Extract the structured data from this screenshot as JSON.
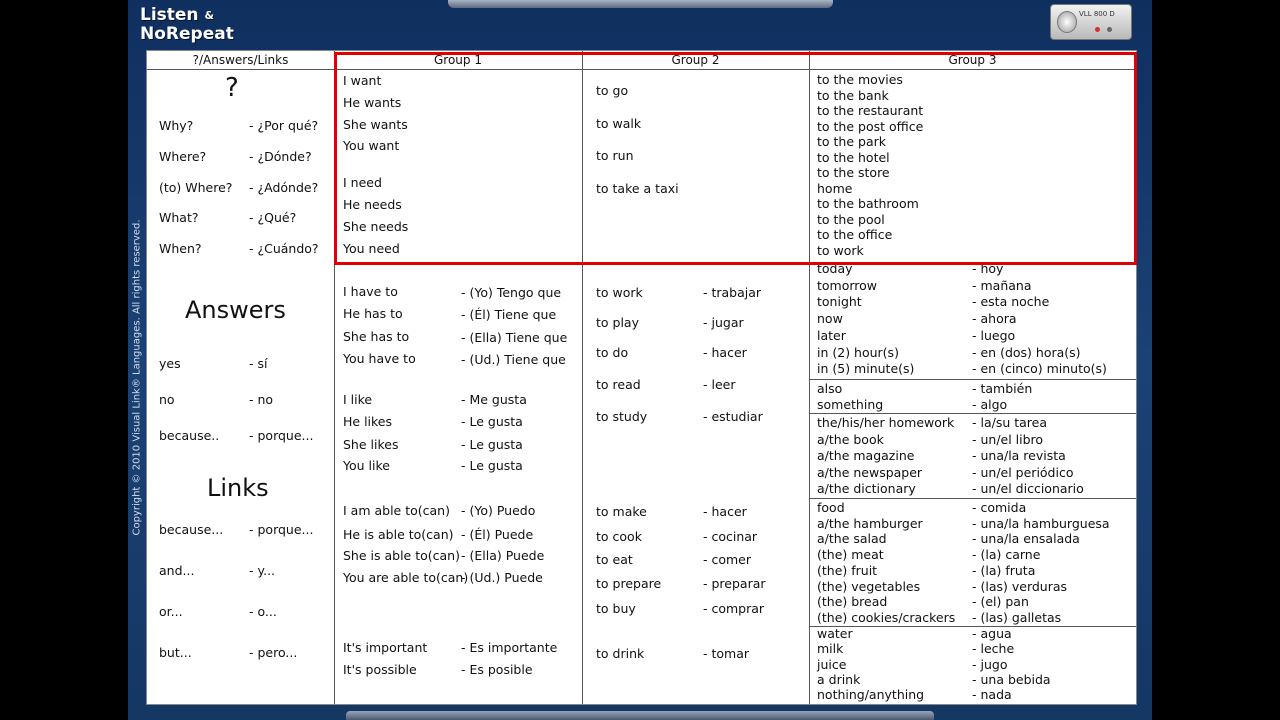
{
  "app": {
    "logo_line1": "Listen",
    "logo_amp": "&",
    "logo_line2": "NoRepeat",
    "device_label": "VLL 800 D",
    "copyright": "Copyright © 2010 Visual Link® Languages. All rights reserved."
  },
  "headers": {
    "col0": "?/Answers/Links",
    "group1": "Group 1",
    "group2": "Group 2",
    "group3": "Group 3"
  },
  "left": {
    "question_mark": "?",
    "questions": [
      {
        "en": "Why?",
        "es": "- ¿Por qué?"
      },
      {
        "en": "Where?",
        "es": "- ¿Dónde?"
      },
      {
        "en": "(to) Where?",
        "es": "- ¿Adónde?"
      },
      {
        "en": "What?",
        "es": "- ¿Qué?"
      },
      {
        "en": "When?",
        "es": "- ¿Cuándo?"
      }
    ],
    "answers_title": "Answers",
    "answers": [
      {
        "en": "yes",
        "es": "- sí"
      },
      {
        "en": "no",
        "es": "- no"
      },
      {
        "en": "because..",
        "es": "- porque..."
      }
    ],
    "links_title": "Links",
    "links": [
      {
        "en": "because...",
        "es": "- porque..."
      },
      {
        "en": "and...",
        "es": "- y..."
      },
      {
        "en": "or...",
        "es": "- o..."
      },
      {
        "en": "but...",
        "es": "- pero..."
      }
    ]
  },
  "group1": {
    "want": [
      "I want",
      "He wants",
      "She wants",
      "You want"
    ],
    "need": [
      "I need",
      "He needs",
      "She needs",
      "You need"
    ],
    "have_to": [
      {
        "en": "I have to",
        "es": "- (Yo) Tengo que"
      },
      {
        "en": "He has to",
        "es": "- (Él) Tiene que"
      },
      {
        "en": "She has to",
        "es": "- (Ella) Tiene que"
      },
      {
        "en": "You have to",
        "es": "- (Ud.) Tiene que"
      }
    ],
    "like": [
      {
        "en": "I like",
        "es": "- Me gusta"
      },
      {
        "en": "He likes",
        "es": "- Le gusta"
      },
      {
        "en": "She likes",
        "es": "- Le gusta"
      },
      {
        "en": "You like",
        "es": "- Le gusta"
      }
    ],
    "able": [
      {
        "en": "I am able to(can)",
        "es": "- (Yo) Puedo"
      },
      {
        "en": "He is able to(can)",
        "es": "- (Él) Puede"
      },
      {
        "en": "She is able to(can)",
        "es": "- (Ella) Puede"
      },
      {
        "en": "You are able to(can)",
        "es": "- (Ud.) Puede"
      }
    ],
    "impersonal": [
      {
        "en": "It's important",
        "es": "- Es importante"
      },
      {
        "en": "It's possible",
        "es": "- Es posible"
      }
    ]
  },
  "group2": {
    "top": [
      "to go",
      "to walk",
      "to run",
      "to take a taxi"
    ],
    "verbs_a": [
      {
        "en": "to work",
        "es": "- trabajar"
      },
      {
        "en": "to play",
        "es": "- jugar"
      },
      {
        "en": "to do",
        "es": "- hacer"
      },
      {
        "en": "to read",
        "es": "- leer"
      },
      {
        "en": "to study",
        "es": "- estudiar"
      }
    ],
    "verbs_b": [
      {
        "en": "to make",
        "es": "- hacer"
      },
      {
        "en": "to cook",
        "es": "- cocinar"
      },
      {
        "en": "to eat",
        "es": "- comer"
      },
      {
        "en": "to prepare",
        "es": "- preparar"
      },
      {
        "en": "to buy",
        "es": "- comprar"
      }
    ],
    "verbs_c": [
      {
        "en": "to drink",
        "es": "- tomar"
      }
    ]
  },
  "group3": {
    "places": [
      "to the movies",
      "to the bank",
      "to the restaurant",
      "to the post office",
      "to the park",
      "to the hotel",
      "to the store",
      "home",
      "to the bathroom",
      "to the pool",
      "to the office",
      "to work"
    ],
    "time": [
      {
        "en": "today",
        "es": "- hoy"
      },
      {
        "en": "tomorrow",
        "es": "- mañana"
      },
      {
        "en": "tonight",
        "es": "- esta noche"
      },
      {
        "en": "now",
        "es": "- ahora"
      },
      {
        "en": "later",
        "es": "- luego"
      },
      {
        "en": "in (2) hour(s)",
        "es": "- en (dos) hora(s)"
      },
      {
        "en": "in (5) minute(s)",
        "es": "- en (cinco) minuto(s)"
      }
    ],
    "also": [
      {
        "en": "also",
        "es": "- también"
      },
      {
        "en": "something",
        "es": "- algo"
      }
    ],
    "reading": [
      {
        "en": "the/his/her homework",
        "es": "- la/su tarea"
      },
      {
        "en": "a/the book",
        "es": "- un/el libro"
      },
      {
        "en": "a/the magazine",
        "es": "- una/la revista"
      },
      {
        "en": "a/the newspaper",
        "es": "- un/el periódico"
      },
      {
        "en": "a/the dictionary",
        "es": "- un/el diccionario"
      }
    ],
    "food": [
      {
        "en": "food",
        "es": "- comida"
      },
      {
        "en": "a/the hamburger",
        "es": "- una/la hamburguesa"
      },
      {
        "en": "a/the salad",
        "es": "- una/la ensalada"
      },
      {
        "en": "(the) meat",
        "es": "- (la) carne"
      },
      {
        "en": "(the) fruit",
        "es": "- (la) fruta"
      },
      {
        "en": "(the) vegetables",
        "es": "- (las) verduras"
      },
      {
        "en": "(the) bread",
        "es": "- (el) pan"
      },
      {
        "en": "(the) cookies/crackers",
        "es": "- (las) galletas"
      }
    ],
    "drinks": [
      {
        "en": "water",
        "es": "- agua"
      },
      {
        "en": "milk",
        "es": "- leche"
      },
      {
        "en": "juice",
        "es": "- jugo"
      },
      {
        "en": "a drink",
        "es": "- una bebida"
      },
      {
        "en": "nothing/anything",
        "es": "- nada"
      }
    ]
  },
  "colors": {
    "highlight": "#e10000",
    "frame": "#1b4275"
  }
}
